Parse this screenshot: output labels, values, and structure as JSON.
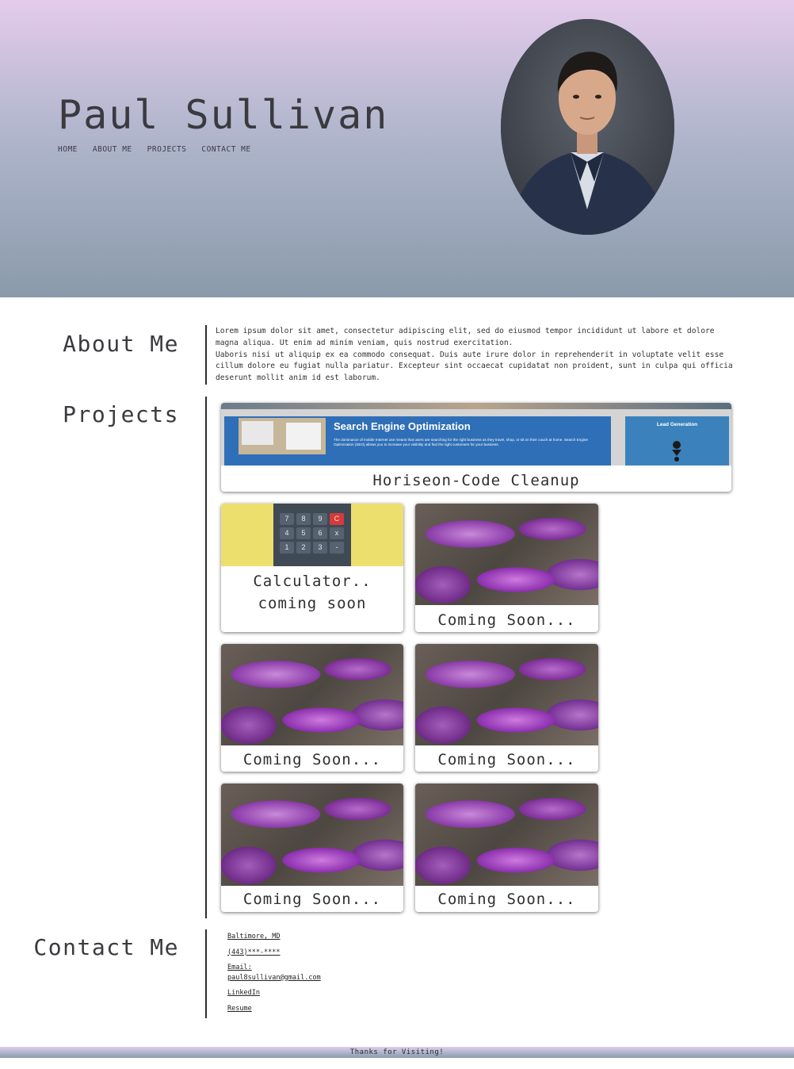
{
  "header": {
    "name": "Paul Sullivan",
    "nav": [
      "HOME",
      "ABOUT ME",
      "PROJECTS",
      "CONTACT ME"
    ]
  },
  "about": {
    "title": "About Me",
    "paragraph_1": "Lorem ipsum dolor sit amet, consectetur adipiscing elit, sed do eiusmod tempor incididunt ut labore et dolore magna aliqua. Ut enim ad minim veniam, quis nostrud exercitation.",
    "paragraph_2": "Uaboris nisi ut aliquip ex ea commodo consequat. Duis aute irure dolor in reprehenderit in voluptate velit esse cillum dolore eu fugiat nulla pariatur. Excepteur sint occaecat cupidatat non proident, sunt in culpa qui officia deserunt mollit anim id est laborum."
  },
  "projects": {
    "title": "Projects",
    "featured": {
      "caption": "Horiseon-Code Cleanup",
      "thumb_heading": "Search Engine Optimization",
      "thumb_text": "The dominance of mobile Internet use means that users are searching for the right business as they travel, shop, or sit on their couch at home. Search Engine Optimization (SEO) allows you to increase your visibility and find the right customers for your business.",
      "side_heading": "Lead Generation"
    },
    "calculator": {
      "caption": "Calculator.. coming soon",
      "keys": [
        "7",
        "8",
        "9",
        "C",
        "4",
        "5",
        "6",
        "x",
        "1",
        "2",
        "3",
        "-"
      ]
    },
    "placeholders": [
      "Coming Soon...",
      "Coming Soon...",
      "Coming Soon...",
      "Coming Soon...",
      "Coming Soon..."
    ]
  },
  "contact": {
    "title": "Contact Me",
    "location": "Baltimore, MD",
    "phone": "(443)***-****",
    "email_label": "Email:",
    "email": "paul8sullivan@gmail.com",
    "linkedin": "LinkedIn",
    "resume": "Resume"
  },
  "footer": {
    "text": "Thanks for Visiting!"
  },
  "colors": {
    "hero_top": "#e4cbec",
    "hero_bottom": "#8a9aab",
    "seo_blue": "#2f6fb7"
  }
}
